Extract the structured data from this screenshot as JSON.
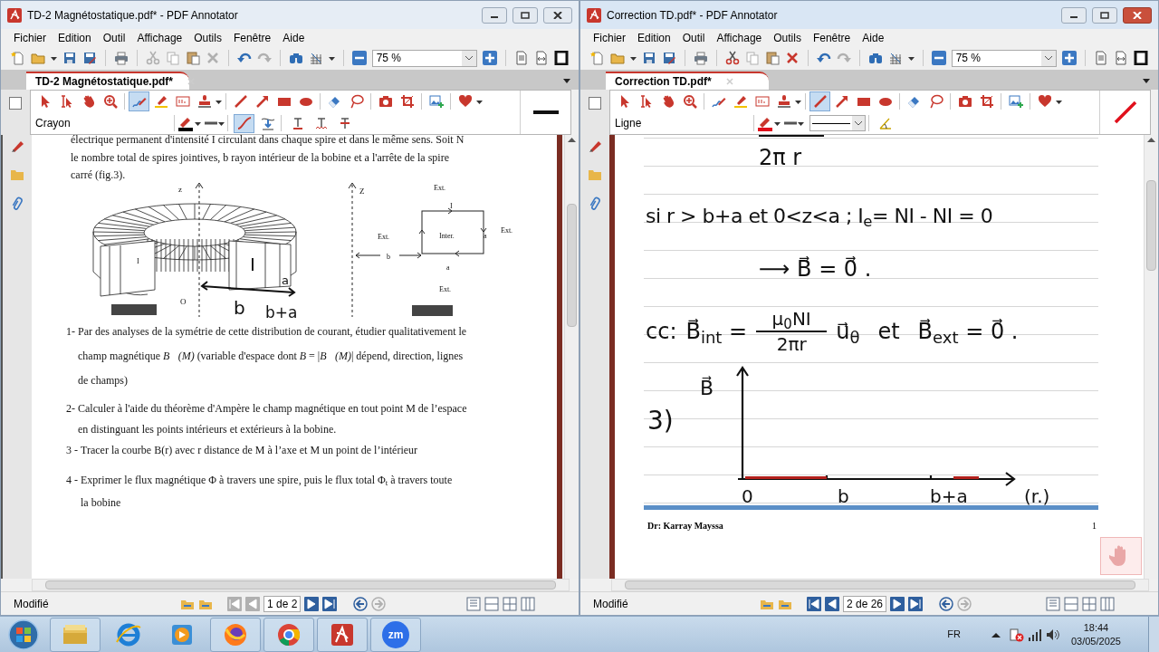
{
  "windows": [
    {
      "title": "TD-2 Magnétostatique.pdf* - PDF Annotator",
      "active": false,
      "menu": [
        "Fichier",
        "Edition",
        "Outil",
        "Affichage",
        "Outils",
        "Fenêtre",
        "Aide"
      ],
      "toolbar": [
        {
          "kind": "new"
        },
        {
          "kind": "open"
        },
        {
          "kind": "save"
        },
        {
          "kind": "saveas"
        },
        {
          "kind": "print"
        },
        {
          "kind": "cut",
          "disabled": true
        },
        {
          "kind": "copy",
          "disabled": true
        },
        {
          "kind": "paste"
        },
        {
          "kind": "delete",
          "disabled": true
        },
        {
          "kind": "undo"
        },
        {
          "kind": "redo",
          "disabled": true
        },
        {
          "kind": "find"
        },
        {
          "kind": "grid"
        },
        {
          "kind": "zoomout"
        },
        {
          "kind": "zoomin"
        },
        {
          "kind": "page"
        },
        {
          "kind": "pagewidth"
        },
        {
          "kind": "frame"
        }
      ],
      "zoom": "75 %",
      "tab": "TD-2 Magnétostatique.pdf*",
      "tools": [
        {
          "kind": "select",
          "selected": false
        },
        {
          "kind": "textselect",
          "selected": false
        },
        {
          "kind": "hand",
          "selected": false
        },
        {
          "kind": "zoom",
          "selected": false
        },
        {
          "kind": "pen",
          "selected": true
        },
        {
          "kind": "highlighter",
          "selected": false
        },
        {
          "kind": "textbox",
          "selected": false
        },
        {
          "kind": "stamp",
          "selected": false
        },
        {
          "kind": "line",
          "selected": false
        },
        {
          "kind": "arrow",
          "selected": false
        },
        {
          "kind": "rect",
          "selected": false
        },
        {
          "kind": "ellipse",
          "selected": false
        },
        {
          "kind": "eraser",
          "selected": false
        },
        {
          "kind": "lasso",
          "selected": false
        },
        {
          "kind": "camera",
          "selected": false
        },
        {
          "kind": "crop",
          "selected": false
        },
        {
          "kind": "image",
          "selected": false
        },
        {
          "kind": "favorite",
          "selected": false
        }
      ],
      "tool_name": "Crayon",
      "tool_options": [
        {
          "kind": "color",
          "color": "#000000"
        },
        {
          "kind": "width"
        },
        {
          "kind": "smooth",
          "selected": true
        },
        {
          "kind": "snap",
          "selected": false
        },
        {
          "kind": "underline",
          "selected": false
        },
        {
          "kind": "squiggle",
          "selected": false
        },
        {
          "kind": "strike",
          "selected": false
        }
      ],
      "preview": {
        "kind": "pen"
      },
      "document": {
        "kind": "exercise",
        "paragraph": "électrique permanent d'intensité I circulant dans chaque spire et dans le même sens. Soit N\nle nombre total de spires jointives, b rayon intérieur de la bobine et a l'arrête de la spire\ncarré (fig.3).",
        "figure_1_labels": [
          "z",
          "I",
          "O",
          "I",
          "a",
          "b",
          "b+a"
        ],
        "figure_2_labels": [
          "Z",
          "Ext.",
          "I",
          "Ext.",
          "Inter.",
          "a",
          "Ext.",
          "b",
          "a",
          "Ext."
        ],
        "questions": [
          {
            "number": "1-",
            "text": "Par des analyses de la symétrie de cette distribution de courant, étudier qualitativement le\nchamp magnétique  *B⃗(M)*  (variable d'espace dont *B* = |*B⃗(M)*|  dépend, direction, lignes\nde champs)"
          },
          {
            "number": "2-",
            "text": "Calculer à l'aide du théorème d'Ampère le champ magnétique en tout point M de l’espace\nen distinguant les points intérieurs et extérieurs à la bobine."
          },
          {
            "number": "3 -",
            "text": "Tracer la courbe B(r) avec r distance de M à l’axe et M un point de l’intérieur"
          },
          {
            "number": "4 -",
            "text": "Exprimer le flux magnétique Φ à travers une spire, puis le flux total Φ$_{t}$ à travers toute\nla bobine"
          }
        ]
      },
      "status": "Modifié",
      "page": "1 de 2",
      "nav": [
        {
          "kind": "first",
          "disabled": true
        },
        {
          "kind": "prev",
          "disabled": true
        },
        {
          "kind": "next",
          "disabled": false
        },
        {
          "kind": "last",
          "disabled": false
        },
        {
          "kind": "back",
          "disabled": false
        },
        {
          "kind": "forward",
          "disabled": true
        }
      ]
    },
    {
      "title": "Correction TD.pdf* - PDF Annotator",
      "active": true,
      "menu": [
        "Fichier",
        "Edition",
        "Outil",
        "Affichage",
        "Outils",
        "Fenêtre",
        "Aide"
      ],
      "toolbar": [
        {
          "kind": "new"
        },
        {
          "kind": "open"
        },
        {
          "kind": "save"
        },
        {
          "kind": "saveas"
        },
        {
          "kind": "print"
        },
        {
          "kind": "cut",
          "disabled": false
        },
        {
          "kind": "copy",
          "disabled": true
        },
        {
          "kind": "paste"
        },
        {
          "kind": "delete",
          "disabled": false
        },
        {
          "kind": "undo"
        },
        {
          "kind": "redo",
          "disabled": true
        },
        {
          "kind": "find"
        },
        {
          "kind": "grid"
        },
        {
          "kind": "zoomout"
        },
        {
          "kind": "zoomin"
        },
        {
          "kind": "page"
        },
        {
          "kind": "pagewidth"
        },
        {
          "kind": "frame"
        }
      ],
      "zoom": "75 %",
      "tab": "Correction TD.pdf*",
      "tools": [
        {
          "kind": "select",
          "selected": false
        },
        {
          "kind": "textselect",
          "selected": false
        },
        {
          "kind": "hand",
          "selected": false
        },
        {
          "kind": "zoom",
          "selected": false
        },
        {
          "kind": "pen",
          "selected": false
        },
        {
          "kind": "highlighter",
          "selected": false
        },
        {
          "kind": "textbox",
          "selected": false
        },
        {
          "kind": "stamp",
          "selected": false
        },
        {
          "kind": "line",
          "selected": true
        },
        {
          "kind": "arrow",
          "selected": false
        },
        {
          "kind": "rect",
          "selected": false
        },
        {
          "kind": "ellipse",
          "selected": false
        },
        {
          "kind": "eraser",
          "selected": false
        },
        {
          "kind": "lasso",
          "selected": false
        },
        {
          "kind": "camera",
          "selected": false
        },
        {
          "kind": "crop",
          "selected": false
        },
        {
          "kind": "image",
          "selected": false
        },
        {
          "kind": "favorite",
          "selected": false
        }
      ],
      "tool_name": "Ligne",
      "tool_options": [
        {
          "kind": "color",
          "color": "#e0101c"
        },
        {
          "kind": "width"
        },
        {
          "kind": "style"
        },
        {
          "kind": "angle",
          "selected": false
        }
      ],
      "preview": {
        "kind": "line"
      },
      "document": {
        "kind": "notes",
        "formula_tail": "2π r",
        "line_1": "si r > b+a  et 0<z<a ; I$_{e}$= NI - NI = 0",
        "line_2": "⟶  B⃗ = 0⃗ .",
        "conclusion": {
          "label": "cc:",
          "b_int": "B⃗$_{int}$ =",
          "numerator": "μ$_{0}$NI",
          "denominator": "2πr",
          "unit_vector": "u⃗$_{θ}$",
          "joiner": "et",
          "b_ext": "B⃗$_{ext}$ = 0⃗ ."
        },
        "graph": {
          "item": "3)",
          "ylabel": "B⃗",
          "ticks": [
            "0",
            "b",
            "b+a"
          ],
          "xlabel": "(r.)"
        },
        "footer": "Dr: Karray Mayssa",
        "page_number": "1"
      },
      "status": "Modifié",
      "page": "2 de 26",
      "nav": [
        {
          "kind": "first",
          "disabled": false
        },
        {
          "kind": "prev",
          "disabled": false
        },
        {
          "kind": "next",
          "disabled": false
        },
        {
          "kind": "last",
          "disabled": false
        },
        {
          "kind": "back",
          "disabled": false
        },
        {
          "kind": "forward",
          "disabled": true
        }
      ]
    }
  ],
  "taskbar": {
    "apps": [
      {
        "kind": "explorer",
        "running": true
      },
      {
        "kind": "ie",
        "running": false
      },
      {
        "kind": "media",
        "running": false
      },
      {
        "kind": "firefox",
        "running": true
      },
      {
        "kind": "chrome",
        "running": true
      },
      {
        "kind": "annotator",
        "running": true
      },
      {
        "kind": "zoom",
        "label": "zm",
        "running": true
      }
    ],
    "language": "FR",
    "time": "18:44",
    "date": "03/05/2025"
  }
}
